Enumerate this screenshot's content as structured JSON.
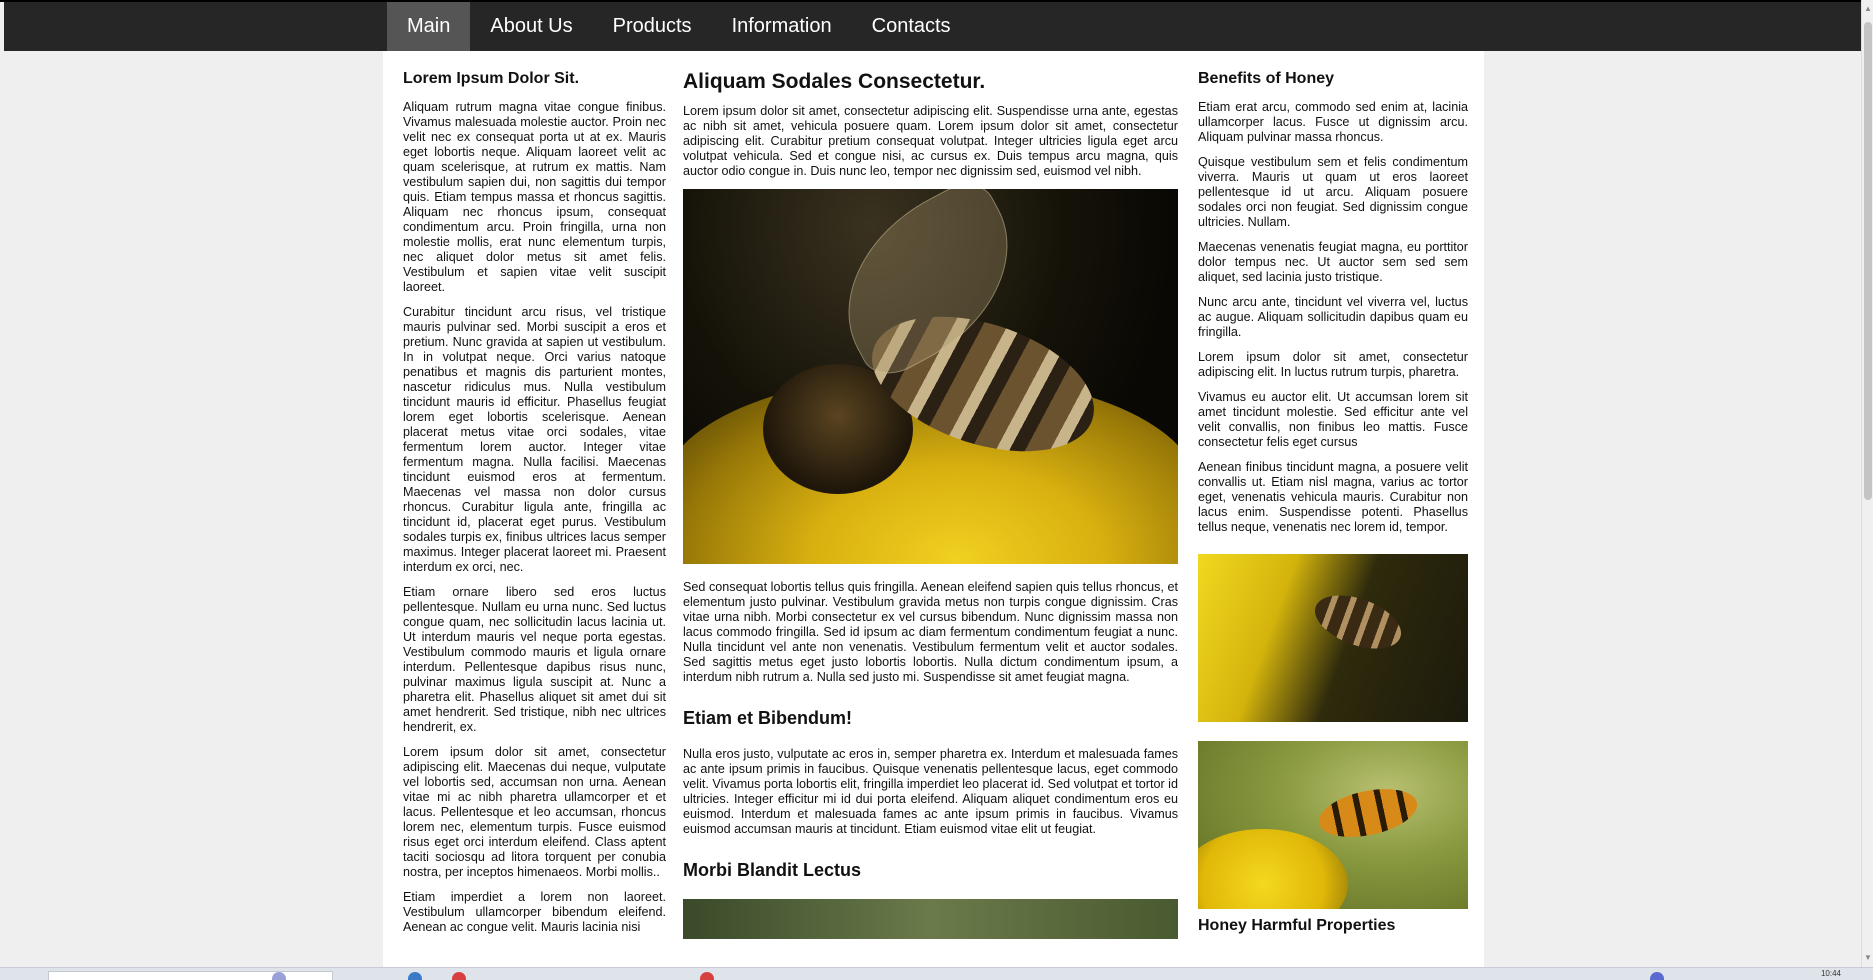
{
  "nav": {
    "items": [
      {
        "label": "Main",
        "active": true
      },
      {
        "label": "About Us",
        "active": false
      },
      {
        "label": "Products",
        "active": false
      },
      {
        "label": "Information",
        "active": false
      },
      {
        "label": "Contacts",
        "active": false
      }
    ]
  },
  "left": {
    "title": "Lorem Ipsum Dolor Sit.",
    "paragraphs": [
      "Aliquam rutrum magna vitae congue finibus. Vivamus malesuada molestie auctor. Proin nec velit nec ex consequat porta ut at ex. Mauris eget lobortis neque. Aliquam laoreet velit ac quam scelerisque, at rutrum ex mattis. Nam vestibulum sapien dui, non sagittis dui tempor quis. Etiam tempus massa et rhoncus sagittis. Aliquam nec rhoncus ipsum, consequat condimentum arcu. Proin fringilla, urna non molestie mollis, erat nunc elementum turpis, nec aliquet dolor metus sit amet felis. Vestibulum et sapien vitae velit suscipit laoreet.",
      "Curabitur tincidunt arcu risus, vel tristique mauris pulvinar sed. Morbi suscipit a eros et pretium. Nunc gravida at sapien ut vestibulum. In in volutpat neque. Orci varius natoque penatibus et magnis dis parturient montes, nascetur ridiculus mus. Nulla vestibulum tincidunt mauris id efficitur. Phasellus feugiat lorem eget lobortis scelerisque. Aenean placerat metus vitae orci sodales, vitae fermentum lorem auctor. Integer vitae fermentum magna. Nulla facilisi. Maecenas tincidunt euismod eros at fermentum. Maecenas vel massa non dolor cursus rhoncus. Curabitur ligula ante, fringilla ac tincidunt id, placerat eget purus. Vestibulum sodales turpis ex, finibus ultrices lacus semper maximus. Integer placerat laoreet mi. Praesent interdum ex orci, nec.",
      "Etiam ornare libero sed eros luctus pellentesque. Nullam eu urna nunc. Sed luctus congue quam, nec sollicitudin lacus lacinia ut. Ut interdum mauris vel neque porta egestas. Vestibulum commodo mauris et ligula ornare interdum. Pellentesque dapibus risus nunc, pulvinar maximus ligula suscipit at. Nunc a pharetra elit. Phasellus aliquet sit amet dui sit amet hendrerit. Sed tristique, nibh nec ultrices hendrerit, ex.",
      "Lorem ipsum dolor sit amet, consectetur adipiscing elit. Maecenas dui neque, vulputate vel lobortis sed, accumsan non urna. Aenean vitae mi ac nibh pharetra ullamcorper et et lacus. Pellentesque et leo accumsan, rhoncus lorem nec, elementum turpis. Fusce euismod risus eget orci interdum eleifend. Class aptent taciti sociosqu ad litora torquent per conubia nostra, per inceptos himenaeos. Morbi mollis..",
      "Etiam imperdiet a lorem non laoreet. Vestibulum ullamcorper bibendum eleifend. Aenean ac congue velit. Mauris lacinia nisi"
    ]
  },
  "middle": {
    "title": "Aliquam Sodales Consectetur.",
    "intro": "Lorem ipsum dolor sit amet, consectetur adipiscing elit. Suspendisse urna ante, egestas ac nibh sit amet, vehicula posuere quam. Lorem ipsum dolor sit amet, consectetur adipiscing elit. Curabitur pretium consequat volutpat. Integer ultricies ligula eget arcu volutpat vehicula. Sed et congue nisi, ac cursus ex. Duis tempus arcu magna, quis auctor odio congue in. Duis nunc leo, tempor nec dignissim sed, euismod vel nibh.",
    "after_image": "Sed consequat lobortis tellus quis fringilla. Aenean eleifend sapien quis tellus rhoncus, et elementum justo pulvinar. Vestibulum gravida metus non turpis congue dignissim. Cras vitae urna nibh. Morbi consectetur ex vel cursus bibendum. Nunc dignissim massa non lacus commodo fringilla. Sed id ipsum ac diam fermentum condimentum feugiat a nunc. Nulla tincidunt vel ante non venenatis. Vestibulum fermentum velit et auctor sodales. Sed sagittis metus eget justo lobortis lobortis. Nulla dictum condimentum ipsum, a interdum nibh rutrum a. Nulla sed justo mi. Suspendisse sit amet feugiat magna.",
    "section2_title": "Etiam et Bibendum!",
    "section2_text": "Nulla eros justo, vulputate ac eros in, semper pharetra ex. Interdum et malesuada fames ac ante ipsum primis in faucibus. Quisque venenatis pellentesque lacus, eget commodo velit. Vivamus porta lobortis elit, fringilla imperdiet leo placerat id. Sed volutpat et tortor id ultricies. Integer efficitur mi id dui porta eleifend. Aliquam aliquet condimentum eros eu euismod. Interdum et malesuada fames ac ante ipsum primis in faucibus. Vivamus euismod accumsan mauris at tincidunt. Etiam euismod vitae elit ut feugiat.",
    "section3_title": "Morbi Blandit Lectus"
  },
  "right": {
    "title": "Benefits of Honey",
    "paragraphs": [
      "Etiam erat arcu, commodo sed enim at, lacinia ullamcorper lacus. Fusce ut dignissim arcu. Aliquam pulvinar massa rhoncus.",
      "Quisque vestibulum sem et felis condimentum viverra. Mauris ut quam ut eros laoreet pellentesque id ut arcu. Aliquam posuere sodales orci non feugiat. Sed dignissim congue ultricies. Nullam.",
      "Maecenas venenatis feugiat magna, eu porttitor dolor tempus nec. Ut auctor sem sed sem aliquet, sed lacinia justo tristique.",
      "Nunc arcu ante, tincidunt vel viverra vel, luctus ac augue. Aliquam sollicitudin dapibus quam eu fringilla.",
      "Lorem ipsum dolor sit amet, consectetur adipiscing elit. In luctus rutrum turpis, pharetra.",
      "Vivamus eu auctor elit. Ut accumsan lorem sit amet tincidunt molestie. Sed efficitur ante vel velit convallis, non finibus leo mattis. Fusce consectetur felis eget cursus",
      "Aenean finibus tincidunt magna, a posuere velit convallis ut. Etiam nisl magna, varius ac tortor eget, venenatis vehicula mauris. Curabitur non lacus enim. Suspendisse potenti. Phasellus tellus neque, venenatis nec lorem id, tempor."
    ],
    "section2_title": "Honey Harmful Properties"
  },
  "taskbar": {
    "clock": "10:44"
  }
}
